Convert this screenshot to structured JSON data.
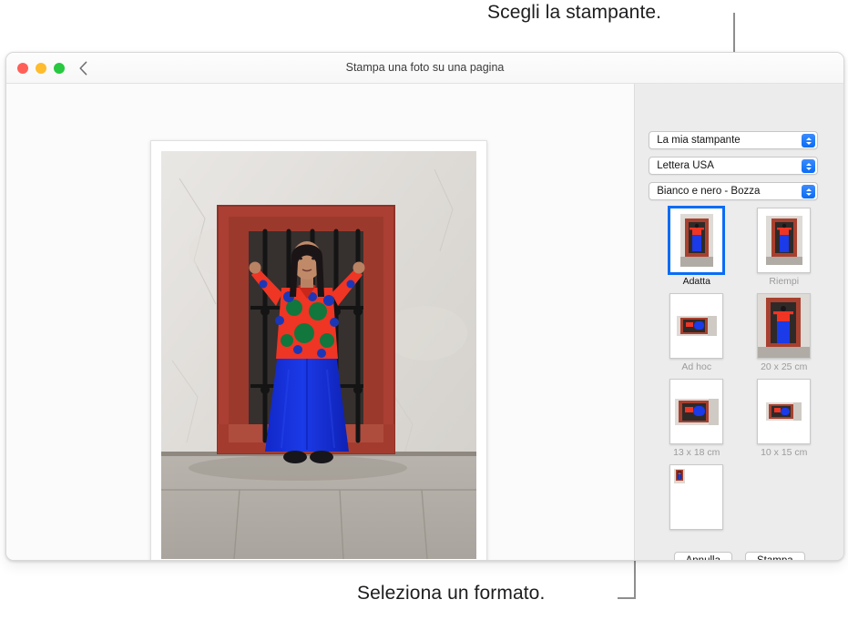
{
  "callouts": {
    "top": "Scegli la stampante.",
    "bottom": "Seleziona un formato."
  },
  "window": {
    "title": "Stampa una foto su una pagina",
    "traffic_lights": [
      "close",
      "minimize",
      "zoom"
    ],
    "back_icon": "chevron-left-icon"
  },
  "sidebar": {
    "popups": [
      {
        "id": "printer",
        "value": "La mia stampante",
        "icon": "stepper-updown-icon"
      },
      {
        "id": "paper",
        "value": "Lettera USA",
        "icon": "stepper-updown-icon"
      },
      {
        "id": "quality",
        "value": "Bianco e nero - Bozza",
        "icon": "stepper-updown-icon"
      }
    ],
    "layouts": [
      {
        "label": "Adatta",
        "selected": true,
        "dim": false,
        "kind": "portrait-full"
      },
      {
        "label": "Riempi",
        "selected": false,
        "dim": true,
        "kind": "portrait-fill"
      },
      {
        "label": "Ad hoc",
        "selected": false,
        "dim": true,
        "kind": "landscape-small"
      },
      {
        "label": "20 x 25 cm",
        "selected": false,
        "dim": true,
        "kind": "portrait-bleed"
      },
      {
        "label": "13 x 18 cm",
        "selected": false,
        "dim": true,
        "kind": "landscape-medium"
      },
      {
        "label": "10 x 15 cm",
        "selected": false,
        "dim": true,
        "kind": "landscape-tiny"
      },
      {
        "label": "",
        "selected": false,
        "dim": true,
        "kind": "contact-sheet"
      }
    ],
    "buttons": {
      "cancel": "Annulla",
      "print": "Stampa"
    }
  },
  "colors": {
    "accent": "#0a6cf5",
    "sidebar_bg": "#ececec",
    "window_bg": "#fbfbfb",
    "callout_line": "#8e8e8e",
    "traffic_red": "#ff5f57",
    "traffic_yellow": "#febc2e",
    "traffic_green": "#28c840"
  }
}
